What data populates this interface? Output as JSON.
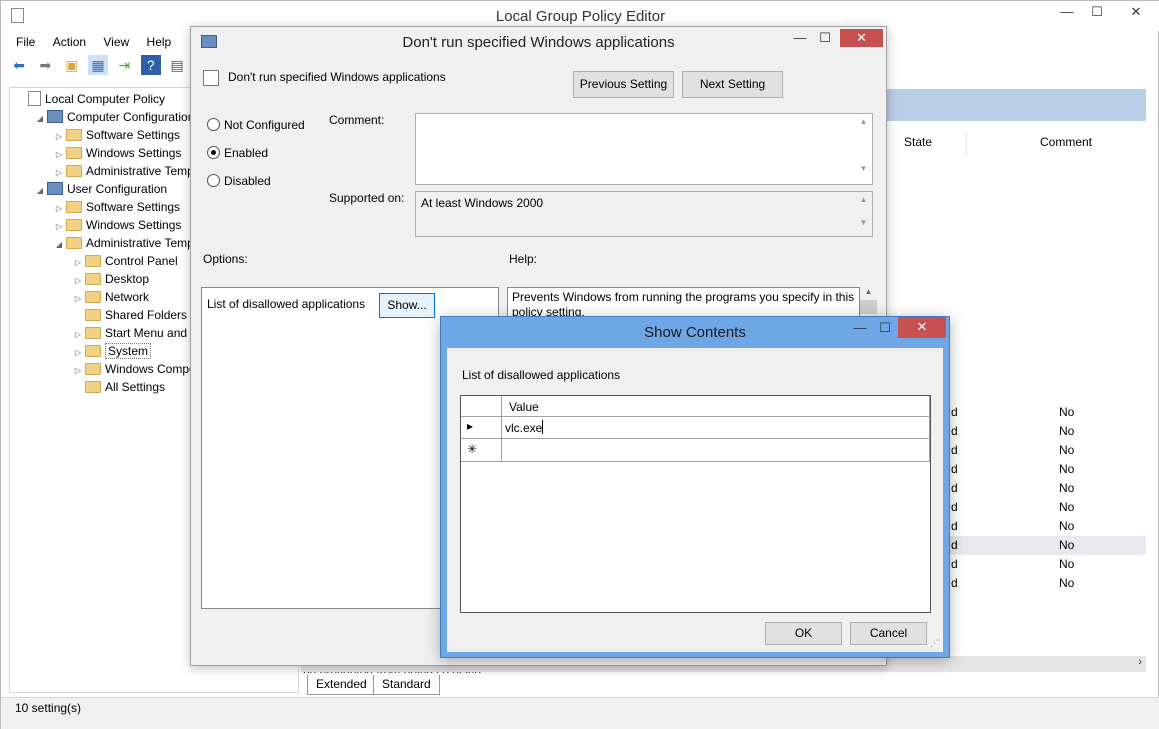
{
  "main": {
    "title": "Local Group Policy Editor",
    "menu": [
      "File",
      "Action",
      "View",
      "Help"
    ],
    "status": "10 setting(s)"
  },
  "tree": {
    "items": [
      {
        "label": "Local Computer Policy",
        "indent": 0,
        "expander": "",
        "icon": "doc"
      },
      {
        "label": "Computer Configuration",
        "indent": 1,
        "expander": "◢",
        "icon": "pc"
      },
      {
        "label": "Software Settings",
        "indent": 2,
        "expander": "▷",
        "icon": "folder"
      },
      {
        "label": "Windows Settings",
        "indent": 2,
        "expander": "▷",
        "icon": "folder"
      },
      {
        "label": "Administrative Templ",
        "indent": 2,
        "expander": "▷",
        "icon": "folder"
      },
      {
        "label": "User Configuration",
        "indent": 1,
        "expander": "◢",
        "icon": "pc"
      },
      {
        "label": "Software Settings",
        "indent": 2,
        "expander": "▷",
        "icon": "folder"
      },
      {
        "label": "Windows Settings",
        "indent": 2,
        "expander": "▷",
        "icon": "folder"
      },
      {
        "label": "Administrative Templ",
        "indent": 2,
        "expander": "◢",
        "icon": "folder"
      },
      {
        "label": "Control Panel",
        "indent": 3,
        "expander": "▷",
        "icon": "folder"
      },
      {
        "label": "Desktop",
        "indent": 3,
        "expander": "▷",
        "icon": "folder"
      },
      {
        "label": "Network",
        "indent": 3,
        "expander": "▷",
        "icon": "folder"
      },
      {
        "label": "Shared Folders",
        "indent": 3,
        "expander": "",
        "icon": "folder"
      },
      {
        "label": "Start Menu and Ta",
        "indent": 3,
        "expander": "▷",
        "icon": "folder"
      },
      {
        "label": "System",
        "indent": 3,
        "expander": "▷",
        "icon": "folder"
      },
      {
        "label": "Windows Compor",
        "indent": 3,
        "expander": "▷",
        "icon": "folder"
      },
      {
        "label": "All Settings",
        "indent": 3,
        "expander": "",
        "icon": "folder"
      }
    ]
  },
  "list": {
    "col_state": "State",
    "col_comment": "Comment",
    "state_cells": [
      "d",
      "d",
      "d",
      "d",
      "d",
      "d",
      "d",
      "d",
      "d",
      "d"
    ],
    "comment_cells": [
      "No",
      "No",
      "No",
      "No",
      "No",
      "No",
      "No",
      "No",
      "No",
      "No"
    ],
    "partial_text": "be prevented from doing so using"
  },
  "tabs": [
    "Extended",
    "Standard"
  ],
  "policy": {
    "title": "Don't run specified Windows applications",
    "setting_name": "Don't run specified Windows applications",
    "prev_button": "Previous Setting",
    "next_button": "Next Setting",
    "radio_not_configured": "Not Configured",
    "radio_enabled": "Enabled",
    "radio_disabled": "Disabled",
    "comment_label": "Comment:",
    "supported_label": "Supported on:",
    "supported_value": "At least Windows 2000",
    "options_label": "Options:",
    "help_label": "Help:",
    "list_label": "List of disallowed applications",
    "show_button": "Show...",
    "help_text": "Prevents Windows from running the programs you specify in this policy setting."
  },
  "show_contents": {
    "title": "Show Contents",
    "list_label": "List of disallowed applications",
    "col_value": "Value",
    "row1_value": "vlc.exe",
    "row1_marker": "▸",
    "new_row_marker": "✳",
    "ok": "OK",
    "cancel": "Cancel"
  }
}
